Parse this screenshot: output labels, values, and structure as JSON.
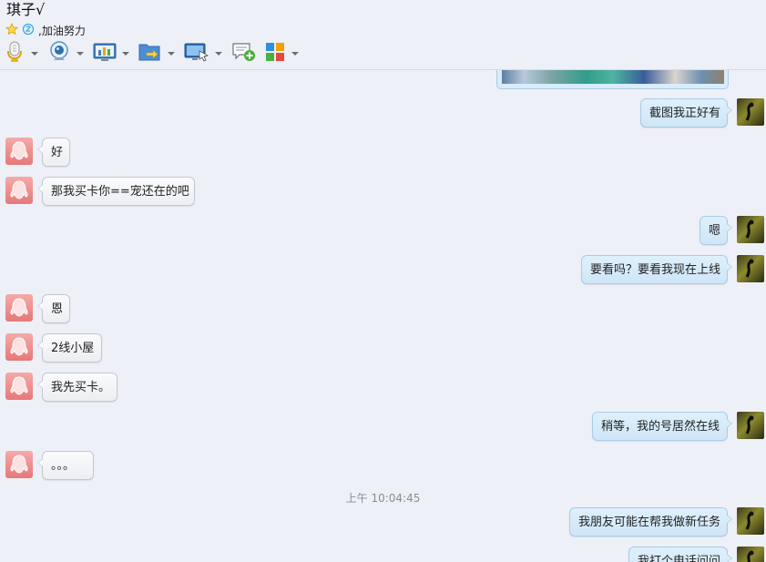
{
  "header": {
    "contact_name": "琪子√",
    "status_text": ",加油努力",
    "icons": [
      "star-icon",
      "qzone-icon"
    ]
  },
  "toolbar": {
    "items": [
      {
        "name": "voice-call",
        "icon": "microphone-icon"
      },
      {
        "name": "video-call",
        "icon": "webcam-icon"
      },
      {
        "name": "app-board",
        "icon": "chart-board-icon"
      },
      {
        "name": "send-file",
        "icon": "folder-send-icon"
      },
      {
        "name": "remote-desktop",
        "icon": "monitor-icon"
      },
      {
        "name": "new-discussion",
        "icon": "chat-add-icon"
      },
      {
        "name": "apps",
        "icon": "apps-grid-icon"
      }
    ]
  },
  "messages": [
    {
      "side": "right",
      "text": "截图我正好有"
    },
    {
      "side": "left",
      "text": "好"
    },
    {
      "side": "left",
      "text": "那我买卡你==宠还在的吧"
    },
    {
      "side": "right",
      "text": "嗯"
    },
    {
      "side": "right",
      "text": "要看吗？要看我现在上线"
    },
    {
      "side": "left",
      "text": "恩"
    },
    {
      "side": "left",
      "text": "2线小屋"
    },
    {
      "side": "left",
      "text": "我先买卡。"
    },
    {
      "side": "right",
      "text": "稍等，我的号居然在线"
    },
    {
      "side": "left",
      "text": "。。。"
    },
    {
      "side": "right",
      "text": "我朋友可能在帮我做新任务"
    },
    {
      "side": "right",
      "text": "我打个电话问问"
    }
  ],
  "timestamp": "上午 10:04:45",
  "colors": {
    "background": "#eef0f8",
    "sent_bubble": "#d9ecf9",
    "received_bubble": "#f4f5f8",
    "timestamp_text": "#8a8d96"
  }
}
